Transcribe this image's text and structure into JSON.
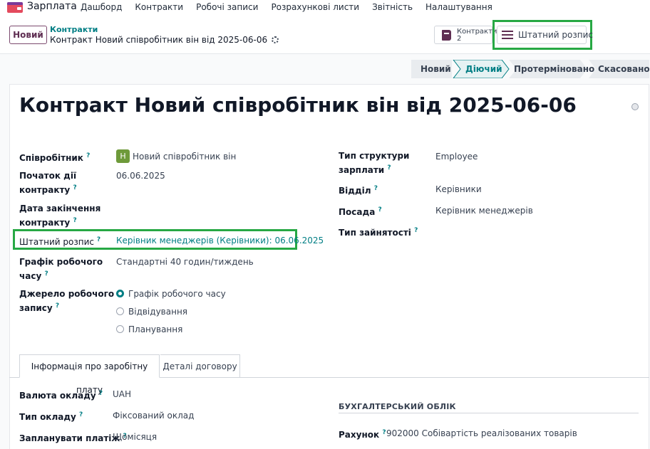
{
  "navbar": {
    "app_name": "Зарплата",
    "menu": [
      "Дашборд",
      "Контракти",
      "Робочі записи",
      "Розрахункові листи",
      "Звітність",
      "Налаштування"
    ]
  },
  "control": {
    "new_button": "Новий",
    "breadcrumb_parent": "Контракти",
    "breadcrumb_current": "Контракт Новий співробітник він від 2025-06-06",
    "smart_contracts_label": "Контракти",
    "smart_contracts_count": "2",
    "smart_staff_label": "Штатний розпис"
  },
  "statusbar": {
    "stages": [
      "Новий",
      "Діючий",
      "Протерміновано",
      "Скасовано"
    ],
    "active_stage": "Діючий"
  },
  "form": {
    "title": "Контракт Новий співробітник він від 2025-06-06",
    "employee_label": "Співробітник",
    "employee_avatar": "Н",
    "employee_value": "Новий співробітник він",
    "start_label_1": "Початок дії",
    "start_label_2": "контракту",
    "start_value": "06.06.2025",
    "end_label_1": "Дата закінчення",
    "end_label_2": "контракту",
    "staff_label": "Штатний розпис",
    "staff_value": "Керівник менеджерів (Керівники): 06.06.2025",
    "schedule_label_1": "Графік робочого",
    "schedule_label_2": "часу",
    "schedule_value": "Стандартні 40 годин/тиждень",
    "source_label_1": "Джерело робочого",
    "source_label_2": "запису",
    "source_options": [
      "Графік робочого часу",
      "Відвідування",
      "Планування"
    ],
    "structure_label_1": "Тип структури",
    "structure_label_2": "зарплати",
    "structure_value": "Employee",
    "department_label": "Відділ",
    "department_value": "Керівники",
    "position_label": "Посада",
    "position_value": "Керівник менеджерів",
    "employment_label": "Тип зайнятості",
    "tip": "?"
  },
  "tabs": [
    "Інформація про заробітну плату",
    "Деталі договору"
  ],
  "salary": {
    "currency_label": "Валюта окладу",
    "currency_value": "UAH",
    "wage_type_label": "Тип окладу",
    "wage_type_value": "Фіксований оклад",
    "schedule_pay_label": "Запланувати платіж",
    "schedule_pay_value": "Щомісяця",
    "accounting_title": "БУХГАЛТЕРСЬКИЙ ОБЛІК",
    "account_label": "Рахунок",
    "account_value": "902000 Собівартість реалізованих товарів"
  },
  "colors": {
    "accent": "#017e84",
    "brand": "#5f2e52",
    "highlight": "#27a844"
  }
}
